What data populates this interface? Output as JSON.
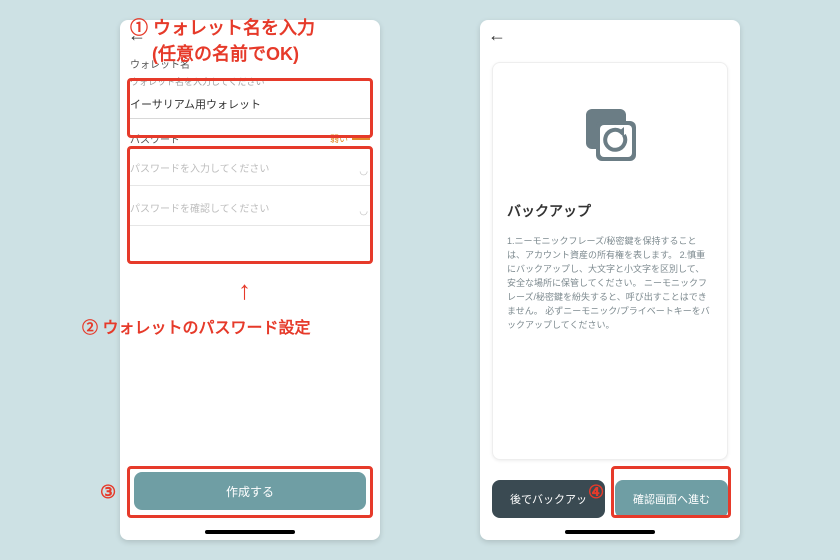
{
  "annotations": {
    "a1_line1": "ウォレット名を入力",
    "a1_line2": "(任意の名前でOK)",
    "a2": "ウォレットのパスワード設定",
    "num1": "①",
    "num2": "②",
    "num3": "③",
    "num4": "④"
  },
  "left": {
    "sections": {
      "wallet_name_label": "ウォレット名",
      "wallet_name_hint": "ウォレット名を入力してください",
      "wallet_name_value": "イーサリアム用ウォレット",
      "password_label": "パスワード",
      "password_strength": "弱い",
      "password_placeholder": "パスワードを入力してください",
      "password_confirm_placeholder": "パスワードを確認してください"
    },
    "create_button": "作成する"
  },
  "right": {
    "card_title": "バックアップ",
    "card_body": "1.ニーモニックフレーズ/秘密鍵を保持することは、アカウント資産の所有権を表します。\n2.慎重にバックアップし、大文字と小文字を区別して、安全な場所に保管してください。 ニーモニックフレーズ/秘密鍵を紛失すると、呼び出すことはできません。 必ずニーモニック/プライベートキーをバックアップしてください。",
    "later_button": "後でバックアッ",
    "proceed_button": "確認画面へ進む"
  }
}
